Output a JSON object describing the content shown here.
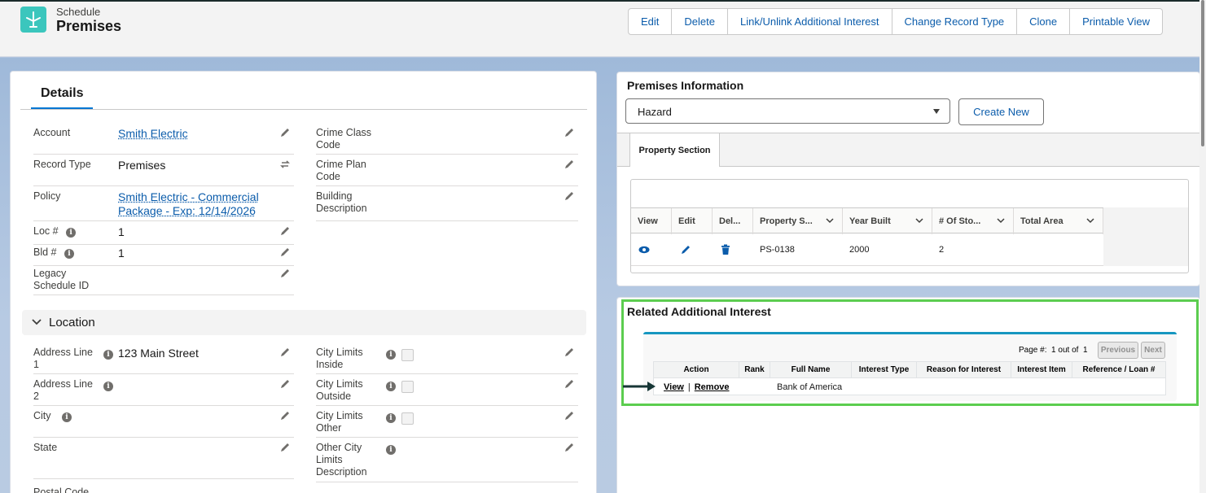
{
  "header": {
    "object_label": "Schedule",
    "record_title": "Premises",
    "actions": [
      "Edit",
      "Delete",
      "Link/Unlink Additional Interest",
      "Change Record Type",
      "Clone",
      "Printable View"
    ]
  },
  "details": {
    "tab_label": "Details",
    "left_fields": [
      {
        "label": "Account",
        "value": "Smith Electric"
      },
      {
        "label": "Record Type",
        "value": "Premises"
      },
      {
        "label": "Policy",
        "value_line1": "Smith Electric - Commercial",
        "value_line2": "Package - Exp: 12/14/2026"
      },
      {
        "label": "Loc #",
        "value": "1"
      },
      {
        "label": "Bld #",
        "value": "1"
      },
      {
        "label_line1": "Legacy",
        "label_line2": "Schedule ID",
        "value": ""
      }
    ],
    "right_fields": [
      {
        "label_line1": "Crime Class",
        "label_line2": "Code"
      },
      {
        "label_line1": "Crime Plan",
        "label_line2": "Code"
      },
      {
        "label_line1": "Building",
        "label_line2": "Description"
      }
    ],
    "location": {
      "title": "Location",
      "left_fields": [
        {
          "label_line1": "Address Line",
          "label_line2": "1",
          "value": "123 Main Street"
        },
        {
          "label_line1": "Address Line",
          "label_line2": "2",
          "value": ""
        },
        {
          "label": "City",
          "value": ""
        },
        {
          "label": "State",
          "value": ""
        },
        {
          "label": "Postal Code",
          "value": ""
        }
      ],
      "right_fields": [
        {
          "label_line1": "City Limits",
          "label_line2": "Inside",
          "checked": false
        },
        {
          "label_line1": "City Limits",
          "label_line2": "Outside",
          "checked": false
        },
        {
          "label_line1": "City Limits",
          "label_line2": "Other",
          "checked": false
        },
        {
          "label_line1": "Other City",
          "label_line2": "Limits",
          "label_line3": "Description"
        }
      ]
    }
  },
  "premises_info": {
    "title": "Premises Information",
    "select_value": "Hazard",
    "create_new_label": "Create New",
    "tab_label": "Property Section",
    "columns": [
      "View",
      "Edit",
      "Del...",
      "Property S...",
      "Year Built",
      "# Of Sto...",
      "Total Area"
    ],
    "rows": [
      {
        "property_section": "PS-0138",
        "year_built": "2000",
        "stories": "2",
        "total_area": ""
      }
    ]
  },
  "related_interest": {
    "title": "Related Additional Interest",
    "page_label": "Page #:",
    "page_text": "1 out of",
    "page_total": "1",
    "previous_label": "Previous",
    "next_label": "Next",
    "columns": [
      "Action",
      "Rank",
      "Full Name",
      "Interest Type",
      "Reason for Interest",
      "Interest Item",
      "Reference / Loan #"
    ],
    "rows": [
      {
        "view": "View",
        "sep": "|",
        "remove": "Remove",
        "rank": "",
        "full_name": "Bank of America",
        "interest_type": "",
        "reason": "",
        "item": "",
        "reference": ""
      }
    ]
  },
  "colors": {
    "accent": "#0176d3",
    "link": "#0b5cab",
    "highlight": "#5ccd4f",
    "app_icon": "#3bc6bd"
  }
}
